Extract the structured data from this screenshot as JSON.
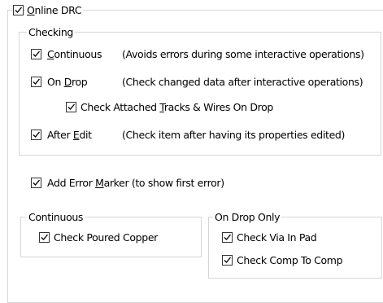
{
  "online_drc": {
    "label_first": "O",
    "label_rest": "nline DRC",
    "checked": true
  },
  "checking": {
    "group_label": "Checking",
    "continuous": {
      "label_first": "C",
      "label_rest": "ontinuous",
      "desc": "(Avoids errors during some interactive operations)",
      "checked": true
    },
    "on_drop": {
      "label_pre": "On ",
      "label_first": "D",
      "label_rest": "rop",
      "desc": "(Check changed data after interactive operations)",
      "checked": true
    },
    "attached": {
      "label_pre": "Check Attached ",
      "label_first": "T",
      "label_rest": "racks & Wires On Drop",
      "checked": true
    },
    "after_edit": {
      "label_pre": "After ",
      "label_first": "E",
      "label_rest": "dit",
      "desc": "(Check item after having its properties edited)",
      "checked": true
    }
  },
  "error_marker": {
    "label_pre": "Add Error ",
    "label_first": "M",
    "label_rest": "arker (to show first error)",
    "checked": true
  },
  "continuous_group": {
    "group_label": "Continuous",
    "poured_copper": {
      "label": "Check Poured Copper",
      "checked": true
    }
  },
  "on_drop_only_group": {
    "group_label": "On Drop Only",
    "via_in_pad": {
      "label": "Check Via In Pad",
      "checked": true
    },
    "comp_to_comp": {
      "label": "Check Comp To Comp",
      "checked": true
    }
  },
  "colors": {
    "group_border": "#d6d6d6",
    "checkbox_border": "#333333"
  }
}
